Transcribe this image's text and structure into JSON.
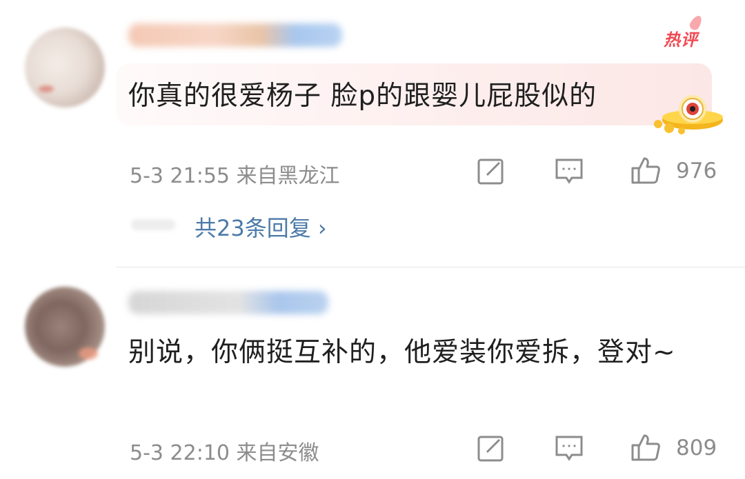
{
  "comments": [
    {
      "text": "你真的很爱杨子 脸p的跟婴儿屁股似的",
      "badge": "热评",
      "date": "5-3 21:55",
      "location": "来自黑龙江",
      "likes": "976",
      "replies_label": "共23条回复 ›",
      "icons": [
        "share-edit-icon",
        "comment-icon",
        "thumbs-up-icon"
      ]
    },
    {
      "text": "别说，你俩挺互补的，他爱装你爱拆，登对~",
      "date": "5-3 22:10",
      "location": "来自安徽",
      "likes": "809",
      "icons": [
        "share-edit-icon",
        "comment-icon",
        "thumbs-up-icon"
      ]
    }
  ],
  "colors": {
    "accent_link": "#4b7aa8",
    "hot_badge": "#f04a54",
    "meta_gray": "#8c8c8c"
  }
}
